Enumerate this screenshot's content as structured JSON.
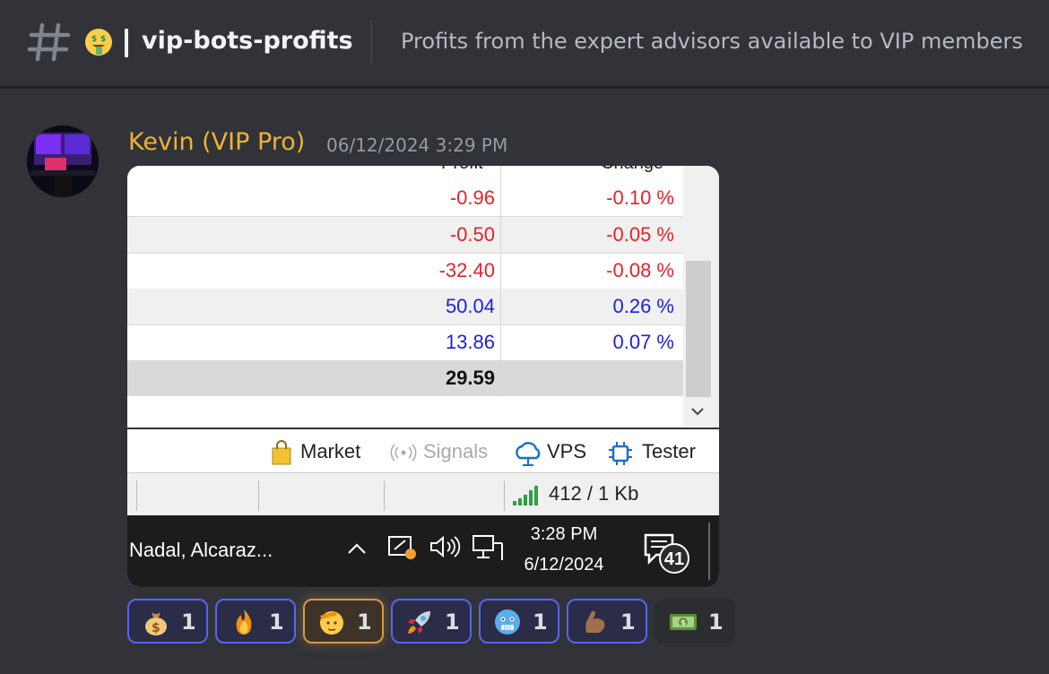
{
  "channel": {
    "name": "vip-bots-profits",
    "topic": "Profits from the expert advisors available to VIP members",
    "emoji": "money-mouth-face"
  },
  "message": {
    "author": "Kevin (VIP Pro)",
    "timestamp": "06/12/2024 3:29 PM"
  },
  "attachment": {
    "columns_cut": [
      "Profit",
      "Change"
    ],
    "rows": [
      {
        "profit": "-0.96",
        "change": "-0.10 %"
      },
      {
        "profit": "-0.50",
        "change": "-0.05 %"
      },
      {
        "profit": "-32.40",
        "change": "-0.08 %"
      },
      {
        "profit": "50.04",
        "change": "0.26 %"
      },
      {
        "profit": "13.86",
        "change": "0.07 %"
      }
    ],
    "total": "29.59",
    "tabs": {
      "market": "Market",
      "signals": "Signals",
      "vps": "VPS",
      "tester": "Tester"
    },
    "status": "412 / 1 Kb",
    "taskbar": {
      "app_label": "Nadal, Alcaraz...",
      "time": "3:28 PM",
      "date": "6/12/2024",
      "notifications": "41"
    }
  },
  "reactions": [
    {
      "emoji": "money-bag",
      "count": "1"
    },
    {
      "emoji": "fire",
      "count": "1"
    },
    {
      "emoji": "saluting-face",
      "count": "1"
    },
    {
      "emoji": "rocket",
      "count": "1"
    },
    {
      "emoji": "cold-face",
      "count": "1"
    },
    {
      "emoji": "flexed-biceps",
      "count": "1"
    },
    {
      "emoji": "dollar-banknote",
      "count": "1"
    }
  ],
  "colors": {
    "background": "#313338",
    "username": "#f0b232",
    "negative": "#e2232a",
    "positive": "#2020e0",
    "reaction_accent": "#5865f2"
  }
}
